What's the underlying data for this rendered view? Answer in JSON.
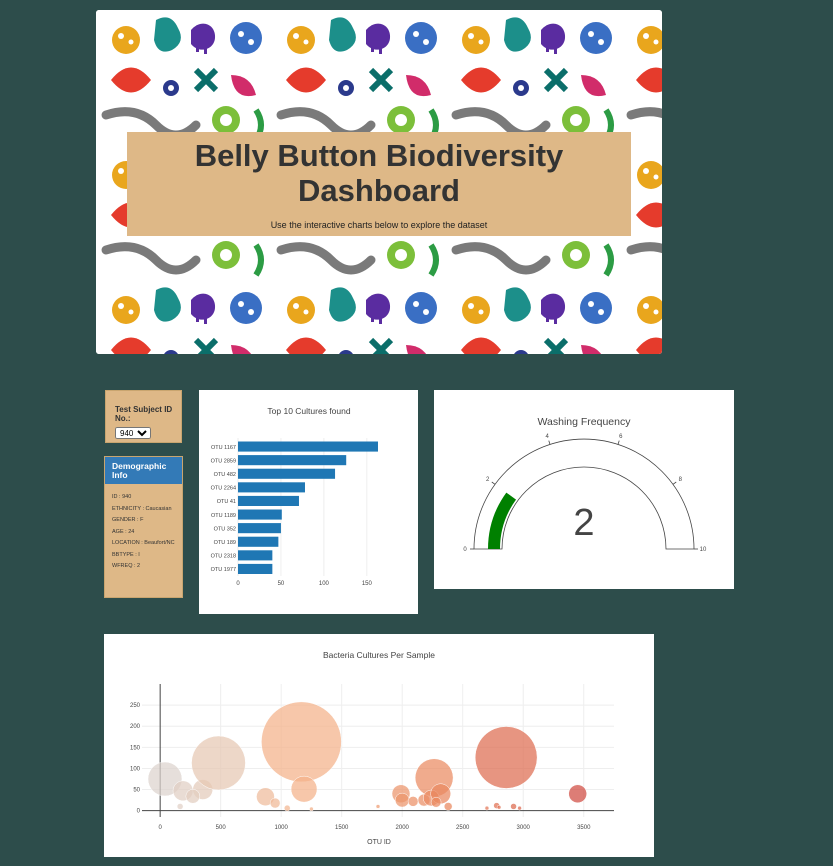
{
  "header": {
    "title_line1": "Belly Button Biodiversity",
    "title_line2": "Dashboard",
    "subtitle": "Use the interactive charts below to explore the dataset"
  },
  "selector": {
    "label": "Test Subject ID No.:",
    "selected": "940"
  },
  "demographic": {
    "title": "Demographic Info",
    "fields": [
      "ID : 940",
      "ETHNICITY : Caucasian",
      "GENDER : F",
      "AGE : 24",
      "LOCATION : Beaufort/NC",
      "BBTYPE : I",
      "WFREQ : 2"
    ]
  },
  "chart_data": [
    {
      "type": "bar",
      "orientation": "horizontal",
      "title": "Top 10 Cultures found",
      "categories": [
        "OTU 1167",
        "OTU 2859",
        "OTU 482",
        "OTU 2264",
        "OTU 41",
        "OTU 1189",
        "OTU 352",
        "OTU 189",
        "OTU 2318",
        "OTU 1977"
      ],
      "values": [
        163,
        126,
        113,
        78,
        71,
        51,
        50,
        47,
        40,
        40
      ],
      "xlim": [
        0,
        170
      ],
      "xticks": [
        0,
        50,
        100,
        150
      ],
      "color": "#1f77b4"
    },
    {
      "type": "gauge",
      "title": "Washing Frequency",
      "value": 2,
      "range": [
        0,
        10
      ],
      "ticks": [
        0,
        2,
        4,
        6,
        8,
        10
      ],
      "bar_color": "#008000"
    },
    {
      "type": "scatter",
      "title": "Bacteria Cultures Per Sample",
      "xlabel": "OTU ID",
      "ylabel": "",
      "xlim": [
        -150,
        3750
      ],
      "ylim": [
        -15,
        300
      ],
      "xticks": [
        0,
        500,
        1000,
        1500,
        2000,
        2500,
        3000,
        3500
      ],
      "yticks": [
        0,
        50,
        100,
        150,
        200,
        250
      ],
      "grid": true,
      "points": [
        {
          "x": 40,
          "y": 75,
          "r": 17
        },
        {
          "x": 189,
          "y": 47,
          "r": 10
        },
        {
          "x": 165,
          "y": 10,
          "r": 3
        },
        {
          "x": 352,
          "y": 50,
          "r": 10
        },
        {
          "x": 270,
          "y": 34,
          "r": 7
        },
        {
          "x": 482,
          "y": 113,
          "r": 27
        },
        {
          "x": 870,
          "y": 33,
          "r": 9
        },
        {
          "x": 950,
          "y": 18,
          "r": 5
        },
        {
          "x": 1050,
          "y": 6,
          "r": 3
        },
        {
          "x": 1167,
          "y": 163,
          "r": 40
        },
        {
          "x": 1189,
          "y": 51,
          "r": 13
        },
        {
          "x": 1250,
          "y": 4,
          "r": 2
        },
        {
          "x": 1800,
          "y": 10,
          "r": 2
        },
        {
          "x": 1990,
          "y": 40,
          "r": 9
        },
        {
          "x": 2000,
          "y": 25,
          "r": 7
        },
        {
          "x": 2090,
          "y": 22,
          "r": 5
        },
        {
          "x": 2180,
          "y": 25,
          "r": 6
        },
        {
          "x": 2264,
          "y": 78,
          "r": 19
        },
        {
          "x": 2240,
          "y": 30,
          "r": 8
        },
        {
          "x": 2318,
          "y": 40,
          "r": 10
        },
        {
          "x": 2280,
          "y": 20,
          "r": 5
        },
        {
          "x": 2380,
          "y": 10,
          "r": 4
        },
        {
          "x": 2700,
          "y": 6,
          "r": 2
        },
        {
          "x": 2780,
          "y": 12,
          "r": 3
        },
        {
          "x": 2800,
          "y": 8,
          "r": 2
        },
        {
          "x": 2859,
          "y": 126,
          "r": 31
        },
        {
          "x": 2920,
          "y": 10,
          "r": 3
        },
        {
          "x": 2970,
          "y": 6,
          "r": 2
        },
        {
          "x": 3450,
          "y": 40,
          "r": 9
        }
      ],
      "colorscale": [
        "#d9d9d9",
        "#f4b38a",
        "#e8835a",
        "#c93a3a"
      ]
    }
  ]
}
